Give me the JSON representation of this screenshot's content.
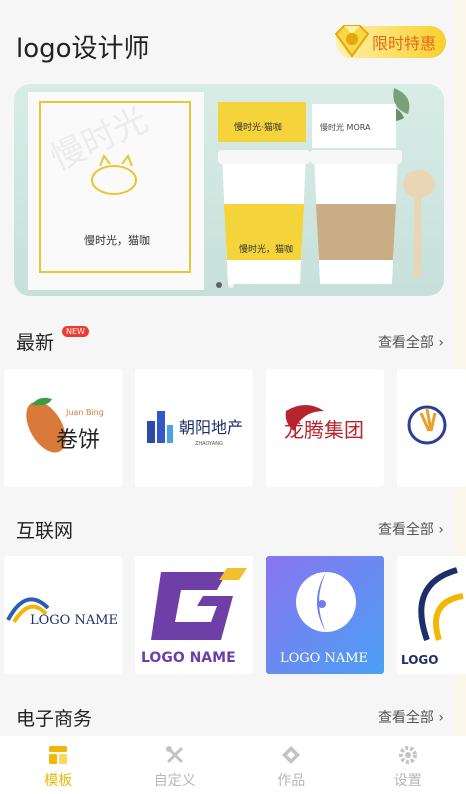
{
  "header": {
    "title": "logo设计师",
    "promo_label": "限时特惠"
  },
  "banner": {
    "dots": 2,
    "active": 1
  },
  "sections": [
    {
      "title": "最新",
      "badge": "NEW",
      "more": "查看全部 ›"
    },
    {
      "title": "互联网",
      "more": "查看全部 ›"
    },
    {
      "title": "电子商务",
      "more": "查看全部 ›"
    }
  ],
  "latest_cards": [
    {
      "text": "卷饼",
      "sub": "Juan Bing"
    },
    {
      "text": "朝阳地产",
      "sub": "ZHAOYANG"
    },
    {
      "text": "龙腾集团"
    },
    {
      "text": ""
    }
  ],
  "internet_cards": [
    {
      "text": "LOGO NAME"
    },
    {
      "text": "LOGO NAME"
    },
    {
      "text": "LOGO NAME"
    },
    {
      "text": "LOGO"
    }
  ],
  "tabs": [
    {
      "label": "模板",
      "active": true
    },
    {
      "label": "自定义",
      "active": false
    },
    {
      "label": "作品",
      "active": false
    },
    {
      "label": "设置",
      "active": false
    }
  ],
  "colors": {
    "accent": "#f2b705",
    "promo_text": "#e56a1c"
  }
}
